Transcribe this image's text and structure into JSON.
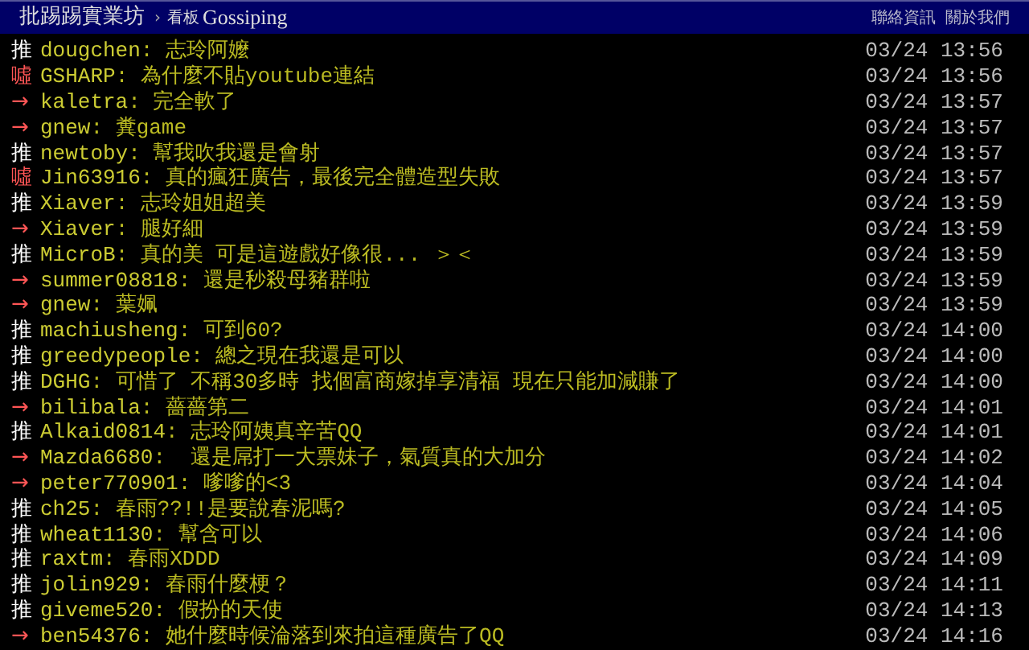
{
  "header": {
    "site": "批踢踢實業坊",
    "separator": "›",
    "board_label": "看板",
    "board": "Gossiping",
    "links": [
      "聯絡資訊",
      "關於我們"
    ]
  },
  "pushes": [
    {
      "kind": "push",
      "tag": "推",
      "user": "dougchen",
      "content": ": 志玲阿嬤",
      "time": "03/24 13:56"
    },
    {
      "kind": "boo",
      "tag": "噓",
      "user": "GSHARP",
      "content": ": 為什麼不貼youtube連結",
      "time": "03/24 13:56"
    },
    {
      "kind": "arrow",
      "tag": "→",
      "user": "kaletra",
      "content": ": 完全軟了",
      "time": "03/24 13:57"
    },
    {
      "kind": "arrow",
      "tag": "→",
      "user": "gnew",
      "content": ": 糞game",
      "time": "03/24 13:57"
    },
    {
      "kind": "push",
      "tag": "推",
      "user": "newtoby",
      "content": ": 幫我吹我還是會射",
      "time": "03/24 13:57"
    },
    {
      "kind": "boo",
      "tag": "噓",
      "user": "Jin63916",
      "content": ": 真的瘋狂廣告，最後完全體造型失敗",
      "time": "03/24 13:57"
    },
    {
      "kind": "push",
      "tag": "推",
      "user": "Xiaver",
      "content": ": 志玲姐姐超美",
      "time": "03/24 13:59"
    },
    {
      "kind": "arrow",
      "tag": "→",
      "user": "Xiaver",
      "content": ": 腿好細",
      "time": "03/24 13:59"
    },
    {
      "kind": "push",
      "tag": "推",
      "user": "MicroB",
      "content": ": 真的美 可是這遊戲好像很... ＞＜",
      "time": "03/24 13:59"
    },
    {
      "kind": "arrow",
      "tag": "→",
      "user": "summer08818",
      "content": ": 還是秒殺母豬群啦",
      "time": "03/24 13:59"
    },
    {
      "kind": "arrow",
      "tag": "→",
      "user": "gnew",
      "content": ": 葉姵",
      "time": "03/24 13:59"
    },
    {
      "kind": "push",
      "tag": "推",
      "user": "machiusheng",
      "content": ": 可到60?",
      "time": "03/24 14:00"
    },
    {
      "kind": "push",
      "tag": "推",
      "user": "greedypeople",
      "content": ": 總之現在我還是可以",
      "time": "03/24 14:00"
    },
    {
      "kind": "push",
      "tag": "推",
      "user": "DGHG",
      "content": ": 可惜了 不稱30多時 找個富商嫁掉享清福 現在只能加減賺了",
      "time": "03/24 14:00"
    },
    {
      "kind": "arrow",
      "tag": "→",
      "user": "bilibala",
      "content": ": 薔薔第二",
      "time": "03/24 14:01"
    },
    {
      "kind": "push",
      "tag": "推",
      "user": "Alkaid0814",
      "content": ": 志玲阿姨真辛苦QQ",
      "time": "03/24 14:01"
    },
    {
      "kind": "arrow",
      "tag": "→",
      "user": "Mazda6680",
      "content": ":  還是屌打一大票妹子，氣質真的大加分",
      "time": "03/24 14:02"
    },
    {
      "kind": "arrow",
      "tag": "→",
      "user": "peter770901",
      "content": ": 嗲嗲的<3",
      "time": "03/24 14:04"
    },
    {
      "kind": "push",
      "tag": "推",
      "user": "ch25",
      "content": ": 春雨??!!是要說春泥嗎?",
      "time": "03/24 14:05"
    },
    {
      "kind": "push",
      "tag": "推",
      "user": "wheat1130",
      "content": ": 幫含可以",
      "time": "03/24 14:06"
    },
    {
      "kind": "push",
      "tag": "推",
      "user": "raxtm",
      "content": ": 春雨XDDD",
      "time": "03/24 14:09"
    },
    {
      "kind": "push",
      "tag": "推",
      "user": "jolin929",
      "content": ": 春雨什麼梗？",
      "time": "03/24 14:11"
    },
    {
      "kind": "push",
      "tag": "推",
      "user": "giveme520",
      "content": ": 假扮的天使",
      "time": "03/24 14:13"
    },
    {
      "kind": "arrow",
      "tag": "→",
      "user": "ben54376",
      "content": ": 她什麼時候淪落到來拍這種廣告了QQ",
      "time": "03/24 14:16"
    }
  ]
}
